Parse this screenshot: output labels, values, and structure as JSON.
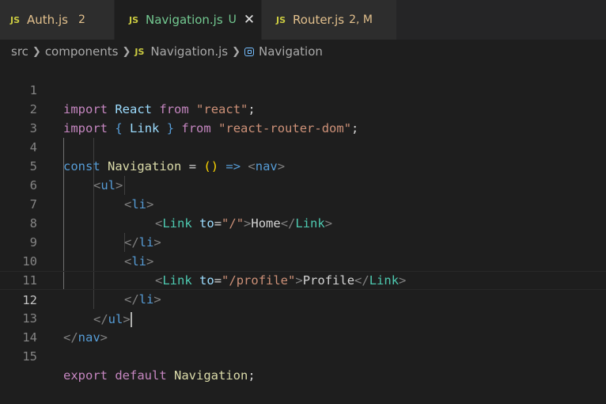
{
  "tabs": [
    {
      "icon": "JS",
      "name": "Auth.js",
      "badge": "2",
      "state": "modified"
    },
    {
      "icon": "JS",
      "name": "Navigation.js",
      "badge": "U",
      "state": "untracked",
      "active": true
    },
    {
      "icon": "JS",
      "name": "Router.js",
      "badge": "2, M",
      "state": "modified"
    }
  ],
  "breadcrumb": {
    "folder1": "src",
    "folder2": "components",
    "file_icon": "JS",
    "file": "Navigation.js",
    "symbol": "Navigation"
  },
  "editor": {
    "current_line": 12,
    "line_numbers": [
      "1",
      "2",
      "3",
      "4",
      "5",
      "6",
      "7",
      "8",
      "9",
      "10",
      "11",
      "12",
      "13",
      "14",
      "15"
    ],
    "lines": {
      "l1": {
        "import": "import",
        "react_id": "React",
        "from": "from",
        "mod": "\"react\"",
        "semi": ";"
      },
      "l2": {
        "import": "import",
        "lb": "{",
        "link": "Link",
        "rb": "}",
        "from": "from",
        "mod": "\"react-router-dom\"",
        "semi": ";"
      },
      "l4": {
        "const": "const",
        "name": "Navigation",
        "eq": "=",
        "parens": "()",
        "arrow": "=>",
        "open": "<",
        "tag": "nav",
        "close": ">"
      },
      "l5": {
        "open": "<",
        "tag": "ul",
        "close": ">"
      },
      "l6": {
        "open": "<",
        "tag": "li",
        "close": ">"
      },
      "l7": {
        "open": "<",
        "tag": "Link",
        "attr": "to",
        "eq": "=",
        "val": "\"/\"",
        "gt": ">",
        "text": "Home",
        "copen": "</",
        "ctag": "Link",
        "cclose": ">"
      },
      "l8": {
        "open": "</",
        "tag": "li",
        "close": ">"
      },
      "l9": {
        "open": "<",
        "tag": "li",
        "close": ">"
      },
      "l10": {
        "open": "<",
        "tag": "Link",
        "attr": "to",
        "eq": "=",
        "val": "\"/profile\"",
        "gt": ">",
        "text": "Profile",
        "copen": "</",
        "ctag": "Link",
        "cclose": ">"
      },
      "l11": {
        "open": "</",
        "tag": "li",
        "close": ">"
      },
      "l12": {
        "open": "</",
        "tag": "ul",
        "close": ">"
      },
      "l13": {
        "open": "</",
        "tag": "nav",
        "close": ">"
      },
      "l15": {
        "export": "export",
        "default": "default",
        "name": "Navigation",
        "semi": ";"
      }
    }
  },
  "colors": {
    "background": "#1e1e1e",
    "tab_inactive": "#2d2d2d",
    "modified": "#e2c08d",
    "untracked": "#73c991",
    "js_icon": "#cbcb41"
  }
}
